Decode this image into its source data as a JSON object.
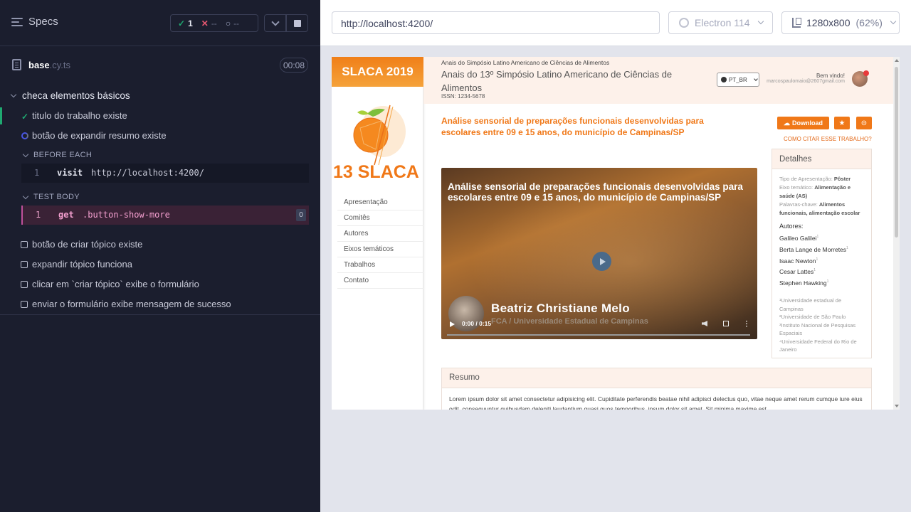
{
  "runner": {
    "specs_label": "Specs",
    "stats": {
      "passed": "1",
      "failed": "--",
      "pending": "--"
    },
    "spec_file": {
      "name": "base",
      "ext": ".cy.ts",
      "duration": "00:08"
    },
    "suite_title": "checa elementos básicos",
    "tests": [
      {
        "label": "titulo do trabalho existe",
        "state": "passed"
      },
      {
        "label": "botão de expandir resumo existe",
        "state": "running"
      },
      {
        "label": "botão de criar tópico existe",
        "state": "queued"
      },
      {
        "label": "expandir tópico funciona",
        "state": "queued"
      },
      {
        "label": "clicar em `criar tópico` exibe o formulário",
        "state": "queued"
      },
      {
        "label": "enviar o formulário exibe mensagem de sucesso",
        "state": "queued"
      }
    ],
    "before_each": {
      "title": "BEFORE EACH",
      "command": {
        "num": "1",
        "name": "visit",
        "arg": "http://localhost:4200/"
      }
    },
    "test_body": {
      "title": "TEST BODY",
      "command": {
        "num": "1",
        "name": "get",
        "arg": ".button-show-more",
        "count": "0"
      }
    }
  },
  "toolbar": {
    "url": "http://localhost:4200/",
    "browser": "Electron 114",
    "viewport": "1280x800",
    "scale": "(62%)"
  },
  "app": {
    "brand": "SLACA 2019",
    "logo_text": "13 SLACA",
    "nav": [
      "Apresentação",
      "Comitês",
      "Autores",
      "Eixos temáticos",
      "Trabalhos",
      "Contato"
    ],
    "header": {
      "small": "Anais do Simpósio Latino Americano de Ciências de Alimentos",
      "title": "Anais do 13º Simpósio Latino Americano de Ciências de Alimentos",
      "issn": "ISSN: 1234-5678",
      "lang": "PT_BR",
      "welcome": "Bem vindo!",
      "email": "marcospaulomaio@2607gmail.com"
    },
    "work_title": "Análise sensorial de preparações funcionais desenvolvidas para escolares entre 09 e 15 anos, do município de Campinas/SP",
    "download_label": "Download",
    "cite_label": "COMO CITAR ESSE TRABALHO?",
    "video": {
      "title": "Análise sensorial de preparações funcionais desenvolvidas para escolares entre 09 e 15 anos, do município de Campinas/SP",
      "speaker": "Beatriz Christiane Melo",
      "affiliation": "FCA / Universidade Estadual de Campinas",
      "time": "0:00 / 0:15",
      "progress": 0
    },
    "details": {
      "title": "Detalhes",
      "tipo_label": "Tipo de Apresentação:",
      "tipo_value": "Pôster",
      "eixo_label": "Eixo temático:",
      "eixo_value": "Alimentação e saúde (AS)",
      "palavras_label": "Palavras-chave:",
      "palavras_value": "Alimentos funcionais, alimentação escolar",
      "authors_title": "Autores:",
      "authors": [
        {
          "name": "Galileo Galilei",
          "sup": "1"
        },
        {
          "name": "Berta Lange de Morretes",
          "sup": "1"
        },
        {
          "name": "Isaac Newton",
          "sup": "1"
        },
        {
          "name": "Cesar Lattes",
          "sup": "1"
        },
        {
          "name": "Stephen Hawking",
          "sup": "1"
        }
      ],
      "affiliations": [
        "¹Universidade estadual de Campinas",
        "²Universidade de São Paulo",
        "³Instituto Nacional de Pesquisas Espaciais",
        "⁴Universidade Federal do Rio de Janeiro"
      ]
    },
    "resumo": {
      "title": "Resumo",
      "text": "Lorem ipsum dolor sit amet consectetur adipisicing elit. Cupiditate perferendis beatae nihil adipisci delectus quo, vitae neque amet rerum cumque iure eius odit, consequuntur quibusdam deleniti laudantium quasi quos temporibus, ipsum dolor sit amet. Sit minima maxime est."
    }
  },
  "colors": {
    "runner_bg": "#1b1e2e",
    "passed": "#1fa971",
    "failed": "#e45770",
    "brand_orange": "#f07818",
    "header_tint": "#fdf1ea"
  }
}
